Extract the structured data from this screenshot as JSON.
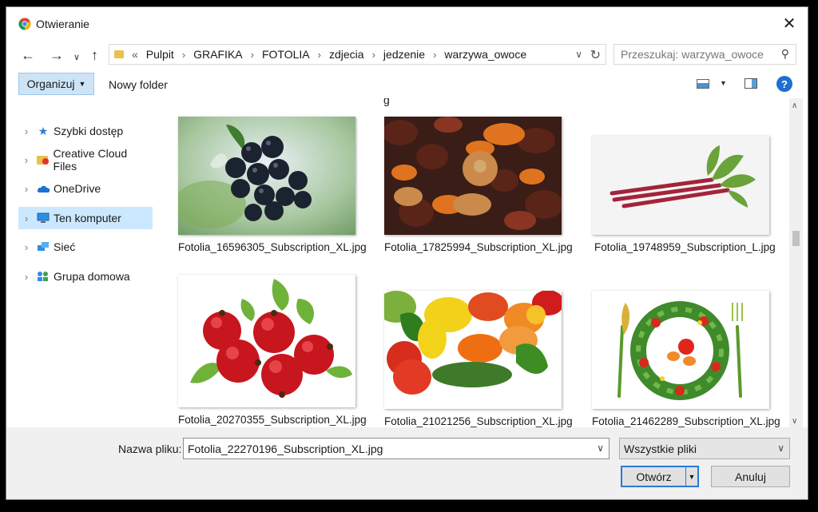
{
  "window": {
    "title": "Otwieranie"
  },
  "nav": {
    "back_icon": "arrow-left-icon",
    "forward_icon": "arrow-right-icon",
    "recent_icon": "chevron-down-icon",
    "up_icon": "arrow-up-icon",
    "breadcrumb_prefix": "«",
    "breadcrumb": [
      "Pulpit",
      "GRAFIKA",
      "FOTOLIA",
      "zdjecia",
      "jedzenie",
      "warzywa_owoce"
    ],
    "search_placeholder": "Przeszukaj: warzywa_owoce"
  },
  "toolbar": {
    "organize_label": "Organizuj",
    "new_folder_label": "Nowy folder",
    "help_label": "?"
  },
  "sidebar": {
    "items": [
      {
        "label": "Szybki dostęp",
        "icon": "star-icon",
        "selected": false
      },
      {
        "label": "Creative Cloud Files",
        "icon": "creative-cloud-folder-icon",
        "selected": false
      },
      {
        "label": "OneDrive",
        "icon": "cloud-icon",
        "selected": false
      },
      {
        "label": "Ten komputer",
        "icon": "computer-icon",
        "selected": true
      },
      {
        "label": "Sieć",
        "icon": "network-icon",
        "selected": false
      },
      {
        "label": "Grupa domowa",
        "icon": "homegroup-icon",
        "selected": false
      }
    ]
  },
  "content": {
    "partial_label": "g",
    "files": [
      {
        "name": "Fotolia_16596305_Subscription_XL.jpg",
        "subject": "black chokeberries"
      },
      {
        "name": "Fotolia_17825994_Subscription_XL.jpg",
        "subject": "dried fruits"
      },
      {
        "name": "Fotolia_19748959_Subscription_L.jpg",
        "subject": "rhubarb stalks"
      },
      {
        "name": "Fotolia_20270355_Subscription_XL.jpg",
        "subject": "rose hips"
      },
      {
        "name": "Fotolia_21021256_Subscription_XL.jpg",
        "subject": "vegetables and fruits"
      },
      {
        "name": "Fotolia_21462289_Subscription_XL.jpg",
        "subject": "vegetable plate with cutlery"
      }
    ]
  },
  "footer": {
    "filename_label": "Nazwa pliku:",
    "filename_value": "Fotolia_22270196_Subscription_XL.jpg",
    "filter_value": "Wszystkie pliki",
    "open_label": "Otwórz",
    "cancel_label": "Anuluj"
  }
}
